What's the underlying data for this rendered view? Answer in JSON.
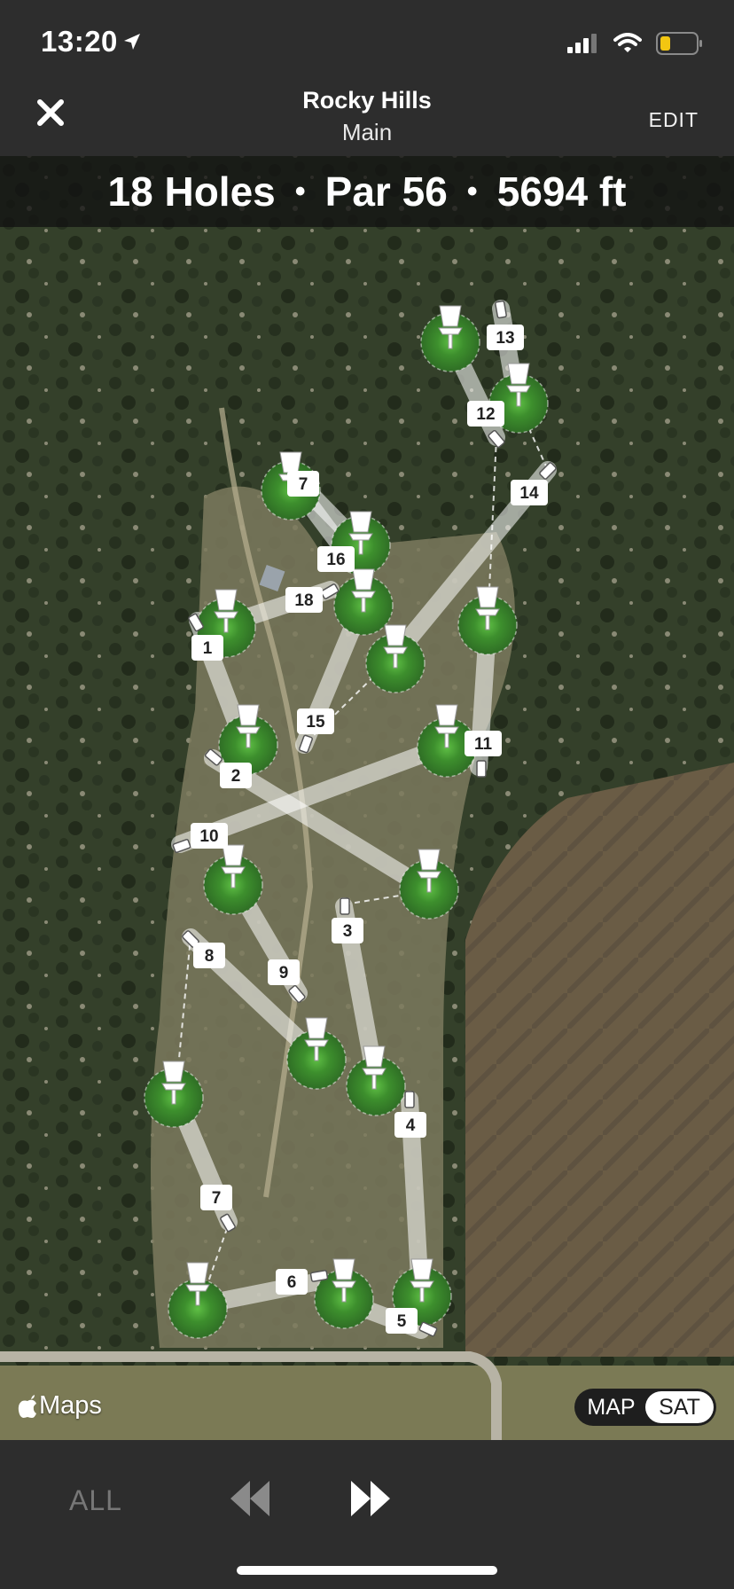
{
  "status_bar": {
    "time": "13:20"
  },
  "header": {
    "title": "Rocky Hills",
    "subtitle": "Main",
    "edit_label": "EDIT"
  },
  "course_info": {
    "holes": "18 Holes",
    "par": "Par 56",
    "distance": "5694 ft",
    "separator": "•"
  },
  "map": {
    "attribution": "Maps",
    "toggle": {
      "map_label": "MAP",
      "sat_label": "SAT",
      "selected": "SAT"
    },
    "holes": [
      "1",
      "2",
      "3",
      "4",
      "5",
      "6",
      "7",
      "8",
      "9",
      "10",
      "11",
      "12",
      "13",
      "14",
      "15",
      "16",
      "7",
      "18"
    ]
  },
  "controls": {
    "all_label": "ALL"
  },
  "icons": {
    "location": "location-arrow-icon",
    "signal": "cellular-signal-icon",
    "wifi": "wifi-icon",
    "battery": "battery-icon",
    "close": "close-icon",
    "basket": "disc-golf-basket-icon",
    "prev": "rewind-icon",
    "next": "fast-forward-icon",
    "apple": "apple-logo-icon"
  },
  "colors": {
    "bar": "#2d2d2d",
    "green": "#3c8a2e",
    "battery": "#f2c611"
  }
}
